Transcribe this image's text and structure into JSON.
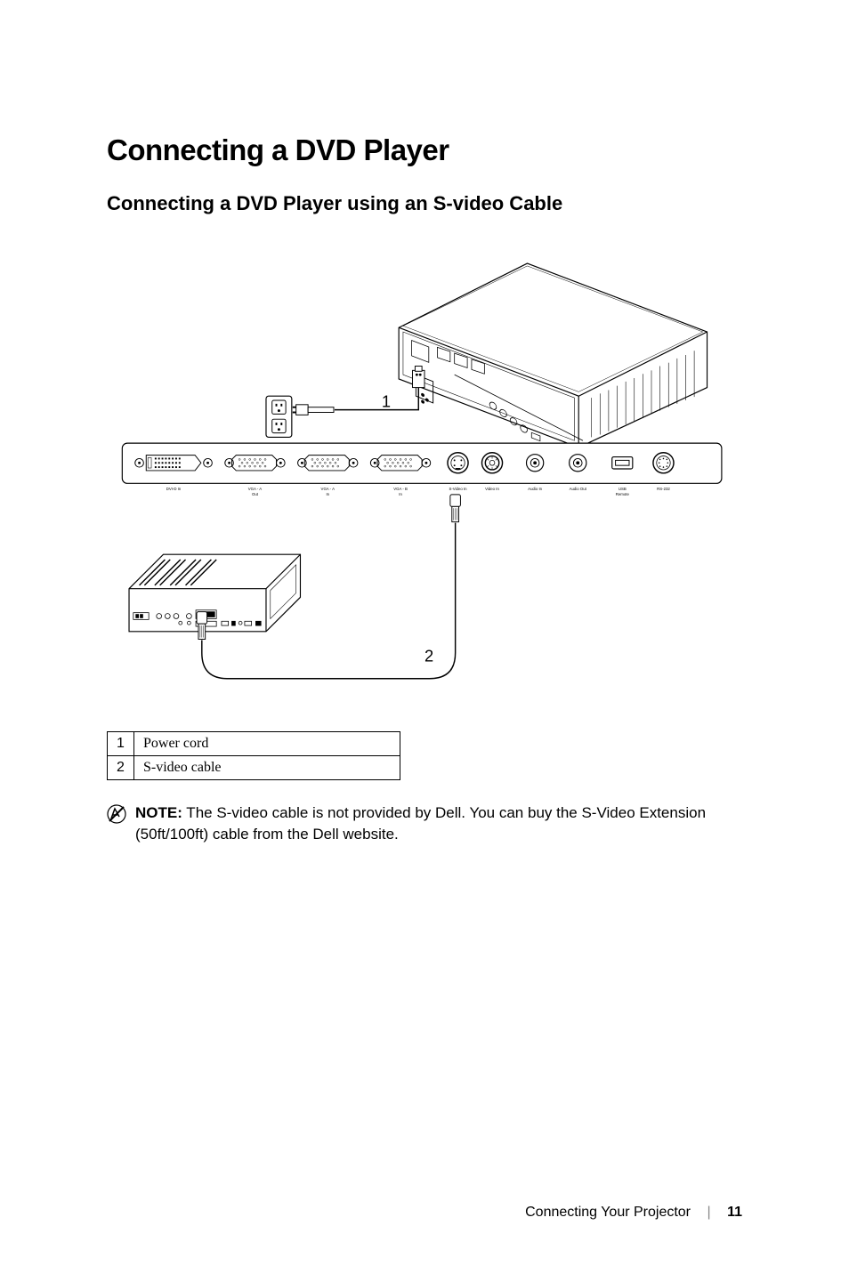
{
  "headings": {
    "main": "Connecting a DVD Player",
    "sub": "Connecting a DVD Player using an S-video Cable"
  },
  "diagram": {
    "callouts": {
      "1": "1",
      "2": "2"
    },
    "ports": {
      "dvi_d_in": "DVI-D In",
      "vga_a_out_1": "VGA - A",
      "vga_a_out_2": "Out",
      "vga_a_in_1": "VGA - A",
      "vga_a_in_2": "In",
      "vga_b_in_1": "VGA - B",
      "vga_b_in_2": "In",
      "s_video_in": "S-Video In",
      "video_in": "Video In",
      "audio_in": "Audio In",
      "audio_out": "Audio Out",
      "usb_1": "USB",
      "usb_2": "Remote",
      "rs232": "RS-232"
    }
  },
  "legend": {
    "row1": {
      "num": "1",
      "label": "Power cord"
    },
    "row2": {
      "num": "2",
      "label": "S-video cable"
    }
  },
  "note": {
    "label": "NOTE:",
    "text_part1": " The S-video cable is not provided by Dell. You can buy the S-Video Extension (50ft/100ft) cable from the Dell website."
  },
  "footer": {
    "section": "Connecting Your Projector",
    "page": "11"
  }
}
